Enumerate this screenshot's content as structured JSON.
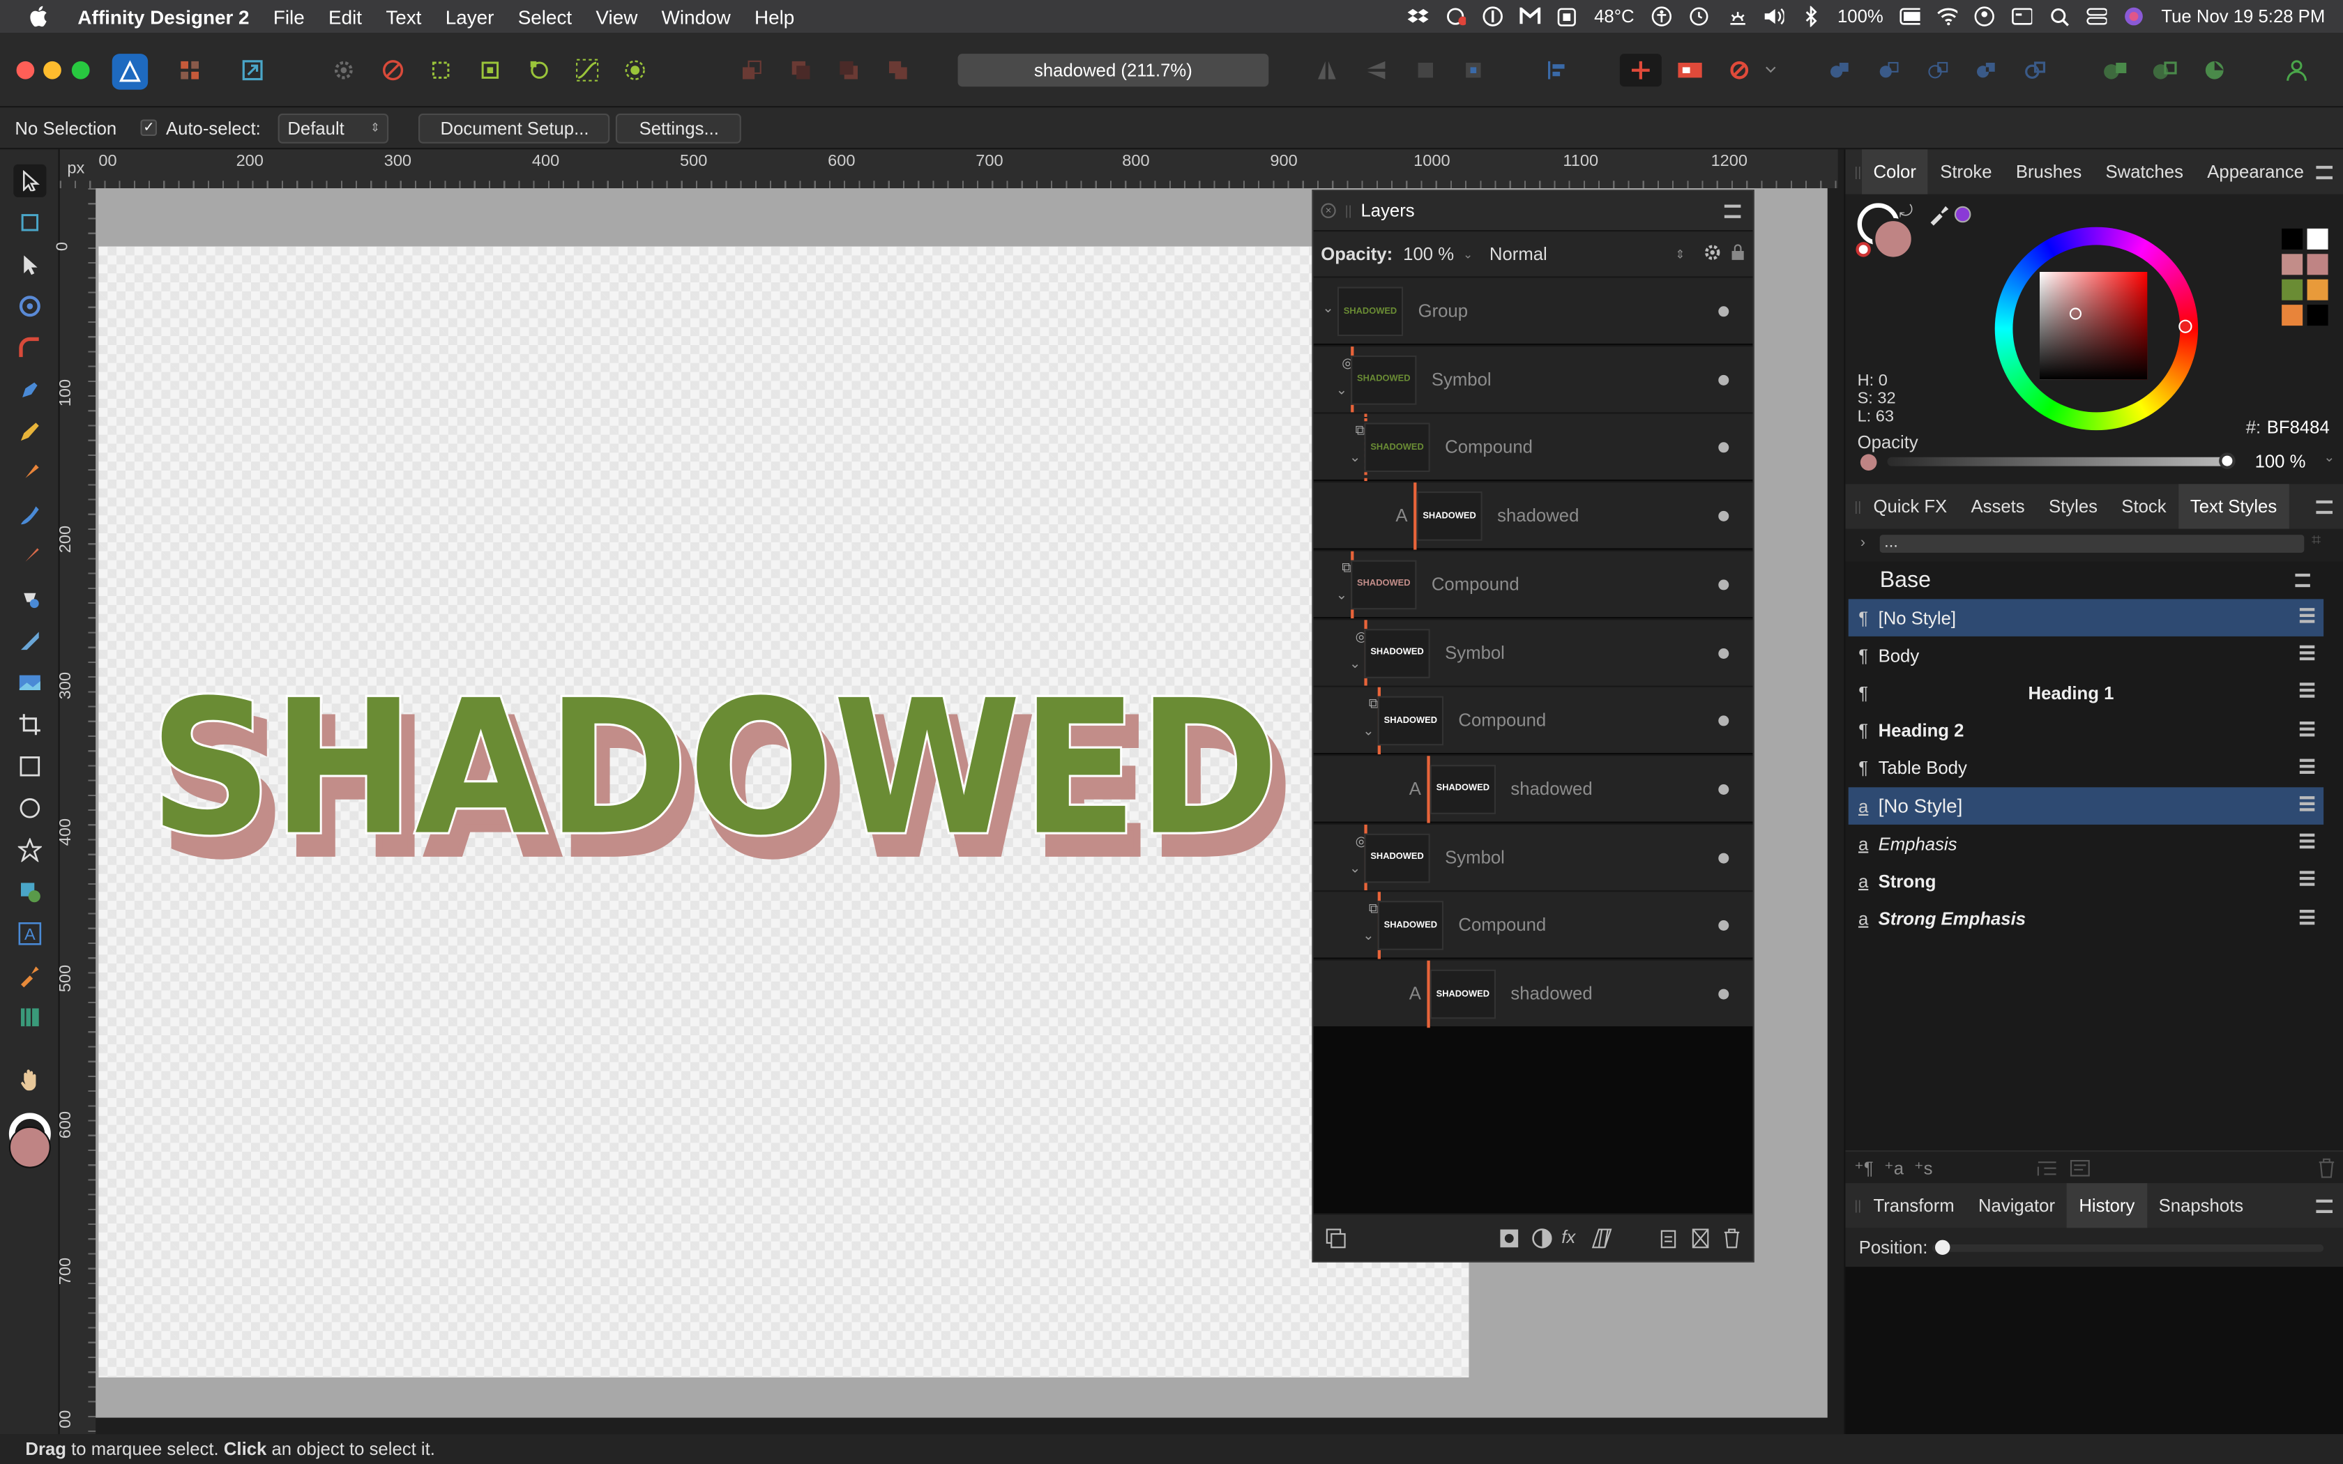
{
  "menubar": {
    "app": "Affinity Designer 2",
    "items": [
      "File",
      "Edit",
      "Text",
      "Layer",
      "Select",
      "View",
      "Window",
      "Help"
    ],
    "temperature": "48°C",
    "battery": "100%",
    "datetime": "Tue Nov 19  5:28 PM"
  },
  "document": {
    "title": "shadowed (211.7%)"
  },
  "context": {
    "selection": "No Selection",
    "auto_select_label": "Auto-select:",
    "auto_select_value": "Default",
    "doc_setup": "Document Setup...",
    "settings": "Settings..."
  },
  "ruler": {
    "unit": "px",
    "top": [
      "00",
      "200",
      "300",
      "400",
      "500",
      "600",
      "700",
      "800",
      "900",
      "1000",
      "1100",
      "1200"
    ],
    "left": [
      "0",
      "100",
      "200",
      "300",
      "400",
      "500",
      "600",
      "700",
      "00"
    ]
  },
  "canvas": {
    "artwork_text": "SHADOWED",
    "fill_color": "#6a8c34",
    "shadow_color": "#c28d89"
  },
  "layers": {
    "title": "Layers",
    "opacity_label": "Opacity:",
    "opacity_value": "100 %",
    "blend": "Normal",
    "rows": [
      {
        "name": "Group",
        "thumb": "SHADOWED"
      },
      {
        "name": "Symbol",
        "thumb": "SHADOWED"
      },
      {
        "name": "Compound",
        "thumb": "SHADOWED"
      },
      {
        "name": "shadowed",
        "thumb": "SHADOWED",
        "kind": "A"
      },
      {
        "name": "Compound",
        "thumb": "SHADOWED"
      },
      {
        "name": "Symbol",
        "thumb": "SHADOWED"
      },
      {
        "name": "Compound",
        "thumb": "SHADOWED"
      },
      {
        "name": "shadowed",
        "thumb": "SHADOWED",
        "kind": "A"
      },
      {
        "name": "Symbol",
        "thumb": "SHADOWED"
      },
      {
        "name": "Compound",
        "thumb": "SHADOWED"
      },
      {
        "name": "shadowed",
        "thumb": "SHADOWED",
        "kind": "A"
      }
    ]
  },
  "color": {
    "tabs": [
      "Color",
      "Stroke",
      "Brushes",
      "Swatches",
      "Appearance"
    ],
    "h": "H: 0",
    "s": "S: 32",
    "l": "L: 63",
    "hex_label": "#:",
    "hex": "BF8484",
    "opacity_label": "Opacity",
    "opacity_value": "100 %",
    "current": "#bf8484"
  },
  "textstyles": {
    "tabs": [
      "Quick FX",
      "Assets",
      "Styles",
      "Stock",
      "Text Styles"
    ],
    "search": "...",
    "group": "Base",
    "items": [
      {
        "label": "[No Style]",
        "icon": "¶",
        "selected": true
      },
      {
        "label": "Body",
        "icon": "¶"
      },
      {
        "label": "Heading 1",
        "icon": "¶"
      },
      {
        "label": "Heading 2",
        "icon": "¶"
      },
      {
        "label": "Table Body",
        "icon": "¶"
      },
      {
        "label": "[No Style]",
        "icon": "a",
        "selected": true
      },
      {
        "label": "Emphasis",
        "icon": "a"
      },
      {
        "label": "Strong",
        "icon": "a"
      },
      {
        "label": "Strong Emphasis",
        "icon": "a"
      }
    ]
  },
  "history": {
    "tabs": [
      "Transform",
      "Navigator",
      "History",
      "Snapshots"
    ],
    "position_label": "Position:"
  },
  "statusbar": {
    "drag": "Drag",
    "text1": " to marquee select. ",
    "click": "Click",
    "text2": " an object to select it."
  }
}
